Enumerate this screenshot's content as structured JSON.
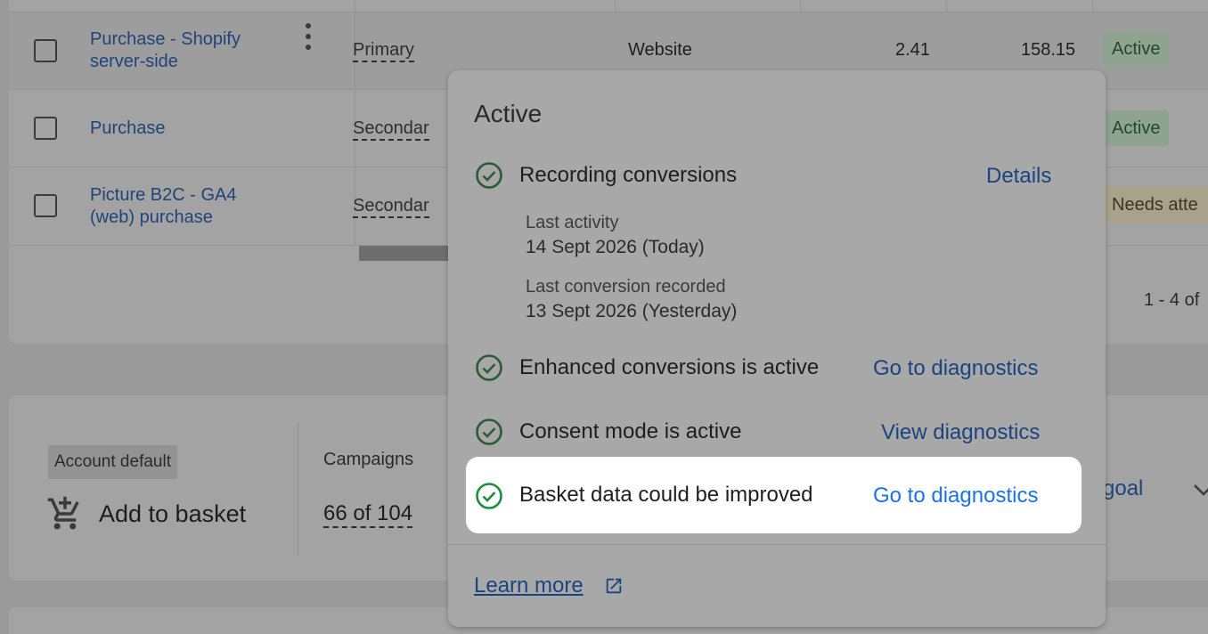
{
  "table": {
    "rows": [
      {
        "name": "Purchase - Shopify server-side",
        "name_line1": "Purchase - Shopify",
        "name_line2": "server-side",
        "optimisation": "Primary",
        "source": "Website",
        "value1": "2.41",
        "value2": "158.15",
        "status": "Active"
      },
      {
        "name": "Purchase",
        "optimisation": "Secondary",
        "optimisation_visible": "Secondar",
        "status": "Active"
      },
      {
        "name": "Picture B2C - GA4 (web) purchase",
        "name_line1": "Picture B2C - GA4",
        "name_line2": "(web) purchase",
        "optimisation": "Secondary",
        "optimisation_visible": "Secondar",
        "status": "Needs atte"
      }
    ],
    "pagination": "1 - 4 of"
  },
  "goal_card": {
    "badge": "Account default",
    "icon": "add-to-cart-icon",
    "title": "Add to basket",
    "campaigns_label": "Campaigns",
    "campaigns_value": "66 of 104",
    "goal_link": "goal"
  },
  "popup": {
    "title": "Active",
    "items": [
      {
        "icon": "check-circle-icon",
        "label": "Recording conversions",
        "link": "Details"
      },
      {
        "icon": "check-circle-icon",
        "label": "Enhanced conversions is active",
        "link": "Go to diagnostics"
      },
      {
        "icon": "check-circle-icon",
        "label": "Consent mode is active",
        "link": "View diagnostics"
      },
      {
        "icon": "check-circle-icon",
        "label": "Basket data could be improved",
        "link": "Go to diagnostics"
      }
    ],
    "last_activity_label": "Last activity",
    "last_activity_value": "14 Sept 2026 (Today)",
    "last_conversion_label": "Last conversion recorded",
    "last_conversion_value": "13 Sept 2026 (Yesterday)",
    "learn_more": "Learn more"
  },
  "colors": {
    "check_green": "#1e8e3e",
    "link_blue": "#1a73e8",
    "highlight_bg": "#ffffff"
  }
}
